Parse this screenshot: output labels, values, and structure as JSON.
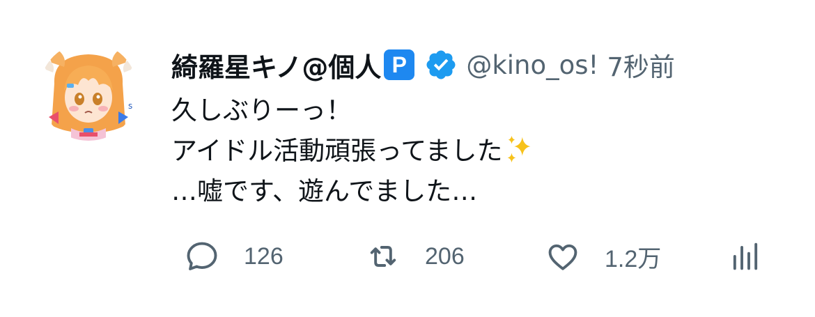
{
  "author": {
    "display_name": "綺羅星キノ@個人",
    "badge_letter": "P",
    "handle": "@kino_os!",
    "timestamp": "7秒前",
    "verified_icon": "verified-badge-icon",
    "badge_color": "#1d9bf0"
  },
  "tweet": {
    "lines": [
      "久しぶりーっ！",
      "アイドル活動頑張ってました",
      "…嘘です、遊んでました…"
    ],
    "emoji": "sparkles"
  },
  "actions": {
    "reply_count": "126",
    "retweet_count": "206",
    "like_count": "1.2万",
    "reply_icon": "reply-icon",
    "retweet_icon": "retweet-icon",
    "like_icon": "heart-icon",
    "views_icon": "bar-chart-icon"
  },
  "colors": {
    "text": "#0f1419",
    "secondary": "#536471",
    "accent": "#1d9bf0"
  }
}
